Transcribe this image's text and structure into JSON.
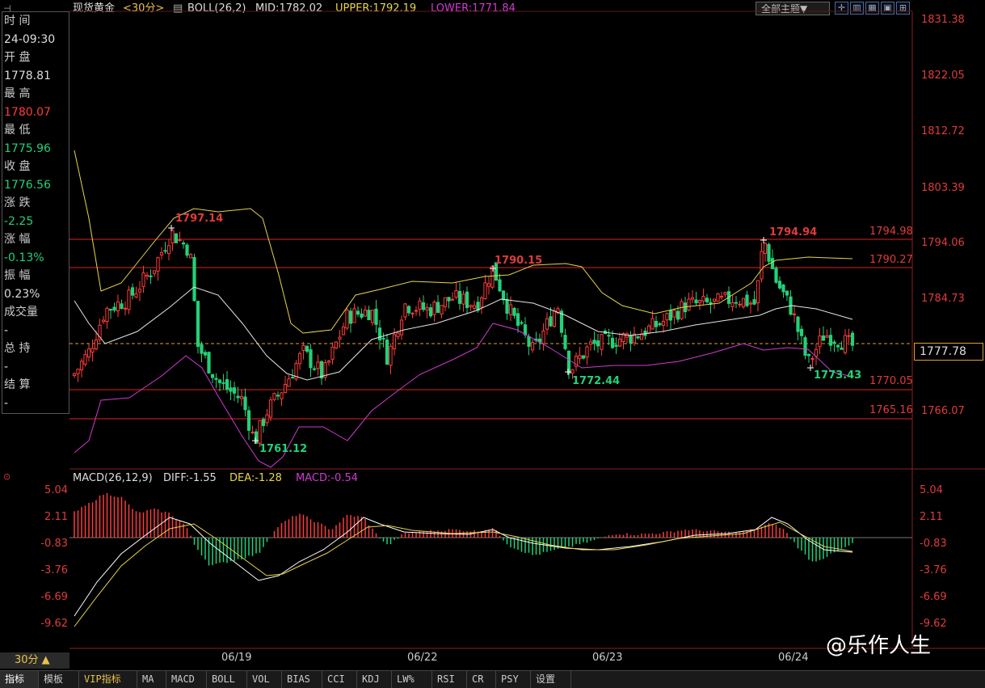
{
  "top_bar": {
    "symbol": "现货黄金",
    "period": "<30分>",
    "indicator_name": "BOLL(26,2)",
    "mid": "MID:1782.02",
    "upper": "UPPER:1792.19",
    "lower": "LOWER:1771.84",
    "theme_button": "全部主题▼",
    "icons": [
      "crosshair-icon",
      "layout-icon",
      "grid-icon",
      "window-icon",
      "expand-icon"
    ]
  },
  "info_panel": {
    "time_label": "时 间",
    "time_value": "24-09:30",
    "open_label": "开 盘",
    "open_value": "1778.81",
    "high_label": "最 高",
    "high_value": "1780.07",
    "low_label": "最 低",
    "low_value": "1775.96",
    "close_label": "收 盘",
    "close_value": "1776.56",
    "change_label": "涨 跌",
    "change_value": "-2.25",
    "change_pct_label": "涨 幅",
    "change_pct_value": "-0.13%",
    "amplitude_label": "振 幅",
    "amplitude_value": "0.23%",
    "volume_label": "成交量",
    "volume_value": "-",
    "hold_label": "总 持",
    "hold_value": "-",
    "settle_label": "结 算",
    "settle_value": "-"
  },
  "price_axis": [
    "1831.38",
    "1822.05",
    "1812.72",
    "1803.39",
    "1794.06",
    "1784.73",
    "1777.78",
    "1766.07"
  ],
  "current_price": "1777.78",
  "levels": [
    "1794.98",
    "1790.27",
    "1770.05",
    "1765.16"
  ],
  "annotations": [
    "1797.14",
    "1790.15",
    "1794.94",
    "1761.12",
    "1772.44",
    "1773.43"
  ],
  "macd": {
    "title": "MACD(26,12,9)",
    "diff": "DIFF:-1.55",
    "dea": "DEA:-1.28",
    "macd": "MACD:-0.54",
    "axis": [
      "5.04",
      "2.11",
      "-0.83",
      "-3.76",
      "-6.69",
      "-9.62"
    ]
  },
  "x_axis": [
    "06/19",
    "06/22",
    "06/23",
    "06/24"
  ],
  "period_selector": "30分 ▲",
  "tabs": [
    "指标",
    "模板",
    "VIP指标",
    "MA",
    "MACD",
    "BOLL",
    "VOL",
    "BIAS",
    "CCI",
    "KDJ",
    "LW%",
    "RSI",
    "CR",
    "PSY",
    "设置"
  ],
  "watermark": "@乐作人生",
  "colors": {
    "up": "#ff3b3b",
    "down": "#22d178",
    "mid_line": "#e6e6e6",
    "upper_line": "#e8d44a",
    "lower_line": "#d13bd1"
  }
}
